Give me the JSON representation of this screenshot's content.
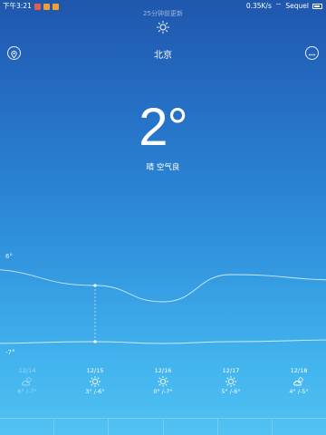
{
  "status_bar": {
    "time": "下午3:21",
    "net_speed": "0.35K/s",
    "carrier": "Sequel",
    "badge_colors": [
      "#e85b50",
      "#f0a030",
      "#f0a030"
    ]
  },
  "header": {
    "update_text": "25分钟前更新",
    "city": "北京",
    "top_icon": "sun-icon",
    "location_icon": "location-pin-icon",
    "more_icon": "more-icon"
  },
  "current": {
    "temperature": "2°",
    "condition": "晴 空气良"
  },
  "chart_data": {
    "type": "line",
    "categories": [
      "12/14",
      "12/15",
      "12/16",
      "12/17",
      "12/18"
    ],
    "series": [
      {
        "values": [
          6,
          3,
          0,
          5,
          4
        ]
      },
      {
        "values": [
          -7,
          -6,
          -7,
          -6,
          -5
        ]
      }
    ],
    "axis_labels": {
      "high": "6°",
      "low": "-7°"
    },
    "selected_index": 1
  },
  "forecast": [
    {
      "date": "12/14",
      "range": "6° /-7°",
      "icon": "partly-cloudy-icon",
      "past": true
    },
    {
      "date": "12/15",
      "range": "3° /-6°",
      "icon": "sun-icon",
      "past": false
    },
    {
      "date": "12/16",
      "range": "0° /-7°",
      "icon": "sun-icon",
      "past": false
    },
    {
      "date": "12/17",
      "range": "5° /-6°",
      "icon": "sun-icon",
      "past": false
    },
    {
      "date": "12/18",
      "range": "4° /-5°",
      "icon": "partly-cloudy-icon",
      "past": false
    }
  ]
}
